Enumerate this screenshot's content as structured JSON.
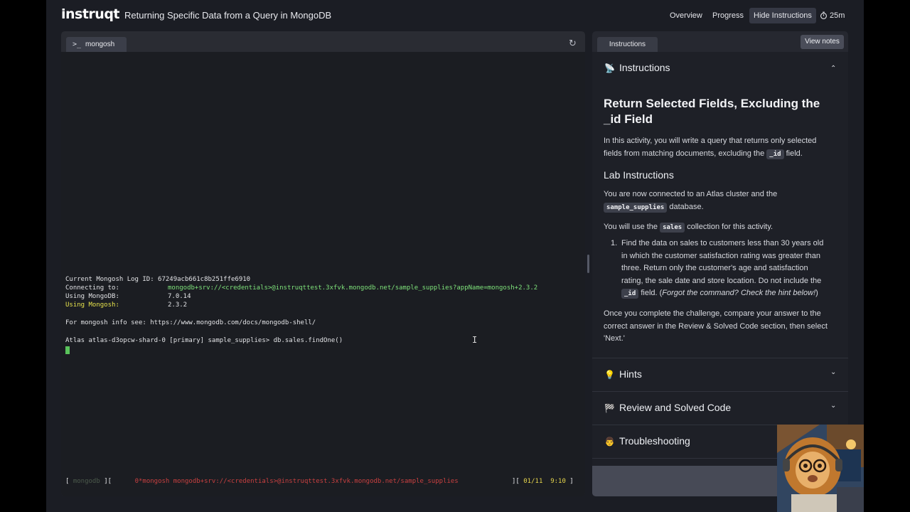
{
  "app": {
    "logo": "instruqt",
    "lab_title": "Returning Specific Data from a Query in MongoDB",
    "nav": {
      "overview": "Overview",
      "progress": "Progress",
      "hide": "Hide Instructions",
      "timer": "25m"
    }
  },
  "terminal": {
    "tab_label": "mongosh",
    "lines": {
      "log_id_label": "Current Mongosh Log ID:",
      "log_id_value": "67249acb661c8b251ffe6910",
      "connecting_label": "Connecting to:",
      "connecting_value": "mongodb+srv://<credentials>@instruqttest.3xfvk.mongodb.net/sample_supplies?appName=mongosh+2.3.2",
      "mongodb_label": "Using MongoDB:",
      "mongodb_value": "7.0.14",
      "mongosh_label": "Using Mongosh:",
      "mongosh_value": "2.3.2",
      "info": "For mongosh info see: https://www.mongodb.com/docs/mongodb-shell/",
      "prompt": "Atlas atlas-d3opcw-shard-0 [primary] sample_supplies> db.sales.findOne()"
    },
    "status": {
      "left_name": "mongodb",
      "session": "0*mongosh mongodb+srv://<credentials>@instruqttest.3xfvk.mongodb.net/sample_supplies",
      "date": "01/11",
      "time": "9:10"
    }
  },
  "instructions": {
    "tab_label": "Instructions",
    "view_notes": "View notes",
    "section_title": "Instructions",
    "heading": "Return Selected Fields, Excluding the _id Field",
    "intro_a": "In this activity, you will write a query that returns only selected fields from matching documents, excluding the ",
    "intro_code": "_id",
    "intro_b": " field.",
    "lab_heading": "Lab Instructions",
    "p2_a": "You are now connected to an Atlas cluster and the ",
    "p2_code": "sample_supplies",
    "p2_b": " database.",
    "p3_a": "You will use the ",
    "p3_code": "sales",
    "p3_b": " collection for this activity.",
    "step_num": "1.",
    "step_a": "Find the data on sales to customers less than 30 years old in which the customer satisfaction rating was greater than three. Return only the customer's age and satisfaction rating, the sale date and store location. Do not include the ",
    "step_code": "_id",
    "step_b": " field. (",
    "step_em": "Forgot the command? Check the hint below!",
    "step_c": ")",
    "p4": "Once you complete the challenge, compare your answer to the correct answer in the Review & Solved Code section, then select 'Next.'",
    "hints": "Hints",
    "review": "Review and Solved Code",
    "troubleshooting": "Troubleshooting"
  },
  "colors": {
    "accent_green": "#7ee27a",
    "accent_yellow": "#e6e24c",
    "panel_bg": "#1e2027"
  }
}
